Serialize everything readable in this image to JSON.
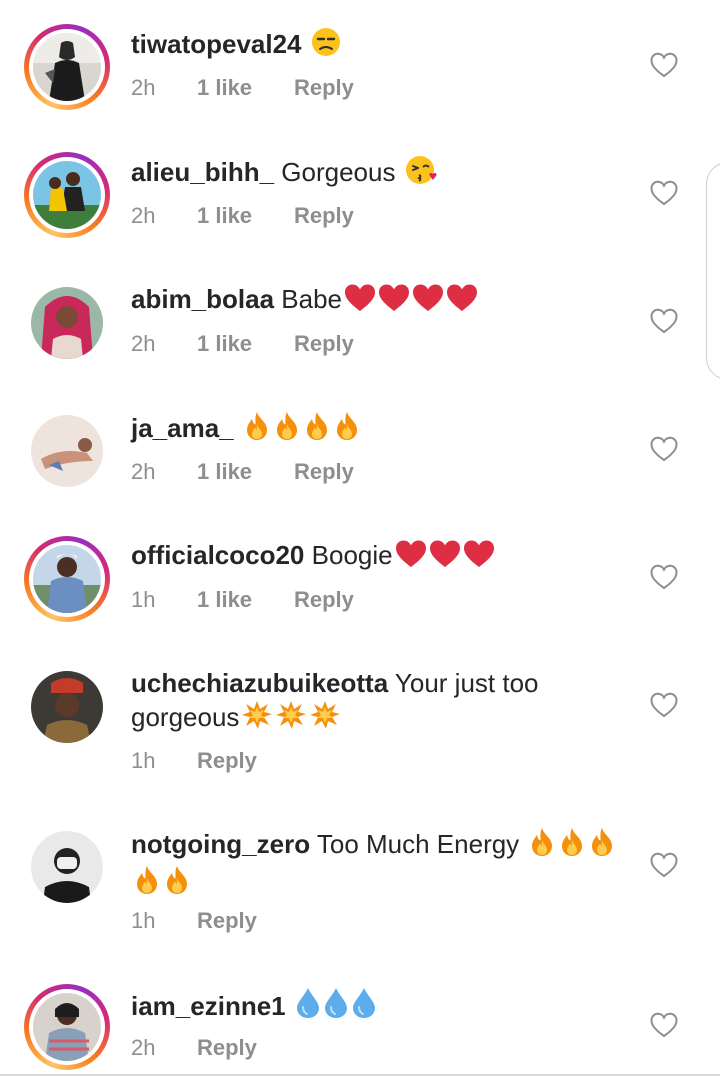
{
  "comments": [
    {
      "username": "tiwatopeval24",
      "text": "",
      "emoji": [
        "unamused-face"
      ],
      "time": "2h",
      "likes": "1 like",
      "reply": "Reply",
      "story_ring": true
    },
    {
      "username": "alieu_bihh_",
      "text": "Gorgeous",
      "emoji": [
        "face-blowing-kiss"
      ],
      "time": "2h",
      "likes": "1 like",
      "reply": "Reply",
      "story_ring": true
    },
    {
      "username": "abim_bolaa",
      "text": "Babe",
      "emoji": [
        "red-heart",
        "red-heart",
        "red-heart",
        "red-heart"
      ],
      "time": "2h",
      "likes": "1 like",
      "reply": "Reply",
      "story_ring": false
    },
    {
      "username": "ja_ama_",
      "text": "",
      "emoji": [
        "fire",
        "fire",
        "fire",
        "fire"
      ],
      "time": "2h",
      "likes": "1 like",
      "reply": "Reply",
      "story_ring": false
    },
    {
      "username": "officialcoco20",
      "text": "Boogie",
      "emoji": [
        "red-heart",
        "red-heart",
        "red-heart"
      ],
      "time": "1h",
      "likes": "1 like",
      "reply": "Reply",
      "story_ring": true
    },
    {
      "username": "uchechiazubuikeotta",
      "text": "Your  just too gorgeous",
      "emoji": [
        "collision",
        "collision",
        "collision"
      ],
      "time": "1h",
      "likes": "",
      "reply": "Reply",
      "story_ring": false
    },
    {
      "username": "notgoing_zero",
      "text": "Too Much Energy",
      "emoji": [
        "fire",
        "fire",
        "fire",
        "fire",
        "fire"
      ],
      "time": "1h",
      "likes": "",
      "reply": "Reply",
      "story_ring": false
    },
    {
      "username": "iam_ezinne1",
      "text": "",
      "emoji": [
        "droplet",
        "droplet",
        "droplet"
      ],
      "time": "2h",
      "likes": "",
      "reply": "Reply",
      "story_ring": true
    }
  ],
  "colors": {
    "text": "#262626",
    "meta": "#8e8e8e",
    "heart_outline": "#8e8e8e",
    "story_ring": [
      "#fdc468",
      "#fa7e1e",
      "#d62976",
      "#962fbf"
    ]
  },
  "icons": {
    "like": "heart-outline-icon"
  }
}
